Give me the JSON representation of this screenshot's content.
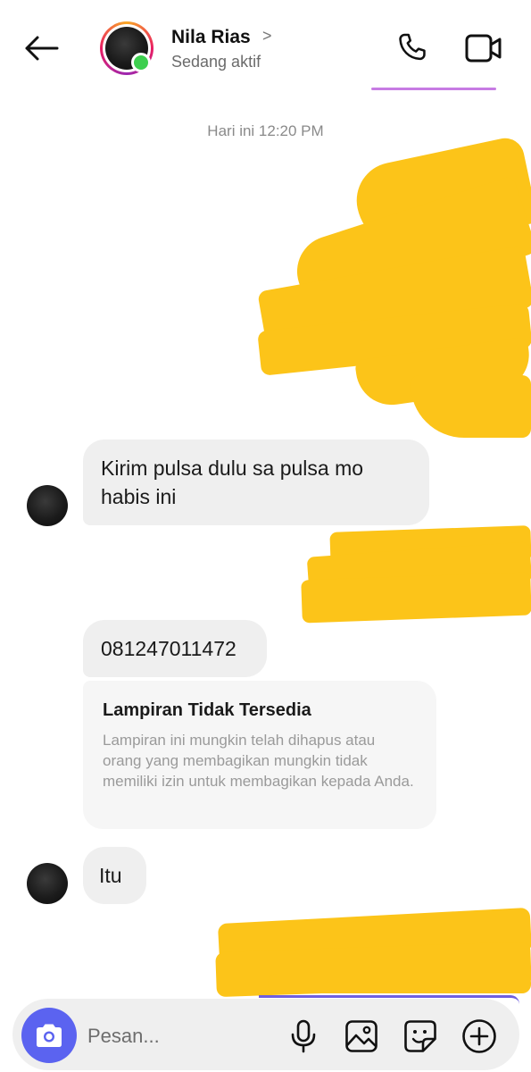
{
  "header": {
    "contact_name": "Nila Rias",
    "contact_status": "Sedang aktif",
    "name_chevron": ">",
    "icons": {
      "back": "arrow-left-icon",
      "call": "phone-icon",
      "video": "video-camera-icon"
    }
  },
  "conversation": {
    "timestamp": "Hari ini 12:20 PM",
    "messages": [
      {
        "sender": "contact",
        "text": "Kirim pulsa dulu sa pulsa mo habis ini"
      },
      {
        "sender": "contact",
        "text": "081247011472"
      },
      {
        "sender": "contact",
        "type": "attachment",
        "title": "Lampiran Tidak Tersedia",
        "description": "Lampiran ini mungkin telah dihapus atau orang yang membagikan mungkin tidak memiliki izin untuk membagikan kepada Anda."
      },
      {
        "sender": "contact",
        "text": "Itu"
      }
    ],
    "redaction_color": "#fcc419"
  },
  "composer": {
    "placeholder": "Pesan...",
    "value": "",
    "accent_color": "#5b63f0",
    "icons": [
      "camera-icon",
      "microphone-icon",
      "image-icon",
      "sticker-icon",
      "plus-circle-icon"
    ]
  }
}
